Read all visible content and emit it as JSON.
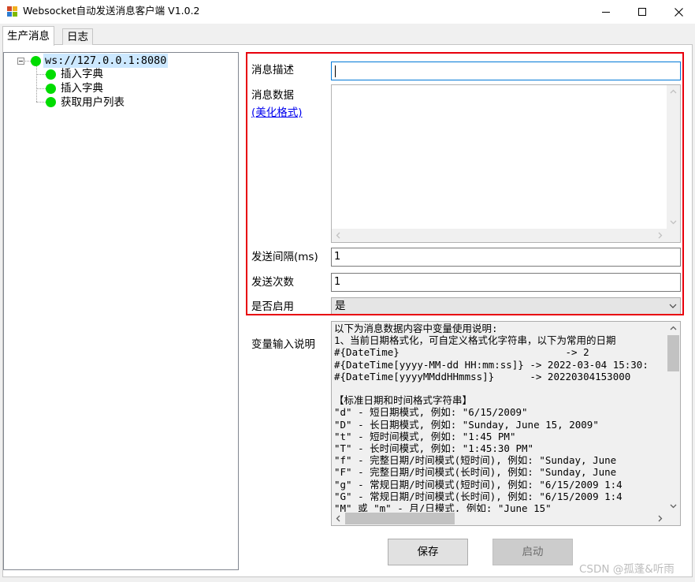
{
  "window": {
    "title": "Websocket自动发送消息客户端 V1.0.2"
  },
  "tabs": [
    {
      "label": "生产消息",
      "active": true
    },
    {
      "label": "日志",
      "active": false
    }
  ],
  "tree": {
    "root": {
      "label": "ws://127.0.0.1:8080",
      "status": "connected",
      "status_color": "#00dc00"
    },
    "children": [
      {
        "label": "插入字典"
      },
      {
        "label": "插入字典"
      },
      {
        "label": "获取用户列表"
      }
    ]
  },
  "form": {
    "description_label": "消息描述",
    "description_value": "",
    "data_label": "消息数据",
    "format_link": "(美化格式)",
    "data_value": "",
    "interval_label": "发送间隔(ms)",
    "interval_value": "1",
    "count_label": "发送次数",
    "count_value": "1",
    "enabled_label": "是否启用",
    "enabled_value": "是",
    "highlight_color": "#e8000c"
  },
  "notes": {
    "label": "变量输入说明",
    "lines": [
      "以下为消息数据内容中变量使用说明:",
      "1、当前日期格式化，可自定义格式化字符串，以下为常用的日期",
      "#{DateTime}                            -> 2",
      "#{DateTime[yyyy-MM-dd HH:mm:ss]} -> 2022-03-04 15:30:",
      "#{DateTime[yyyyMMddHHmmss]}      -> 20220304153000",
      "",
      "【标准日期和时间格式字符串】",
      "\"d\" - 短日期模式, 例如: \"6/15/2009\"",
      "\"D\" - 长日期模式, 例如: \"Sunday, June 15, 2009\"",
      "\"t\" - 短时间模式, 例如: \"1:45 PM\"",
      "\"T\" - 长时间模式, 例如: \"1:45:30 PM\"",
      "\"f\" - 完整日期/时间模式(短时间), 例如: \"Sunday, June",
      "\"F\" - 完整日期/时间模式(长时间), 例如: \"Sunday, June",
      "\"g\" - 常规日期/时间模式(短时间), 例如: \"6/15/2009 1:4",
      "\"G\" - 常规日期/时间模式(长时间), 例如: \"6/15/2009 1:4",
      "\"M\" 或 \"m\" - 月/日模式, 例如: \"June 15\""
    ]
  },
  "buttons": {
    "save": "保存",
    "start": "启动"
  },
  "watermark": "CSDN @孤蓬&听雨"
}
